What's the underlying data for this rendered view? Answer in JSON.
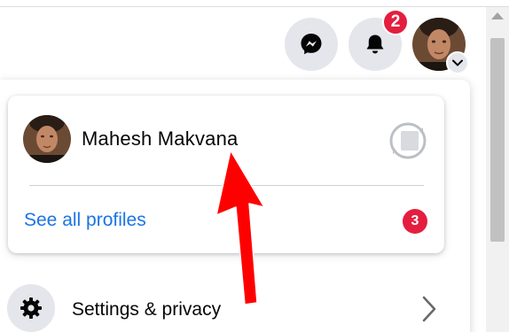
{
  "header": {
    "notifications_count": "2",
    "messenger_icon": "messenger-icon",
    "bell_icon": "bell-icon"
  },
  "profile_card": {
    "name": "Mahesh Makvana",
    "see_all_label": "See all profiles",
    "profiles_count": "3"
  },
  "menu": {
    "settings_label": "Settings & privacy"
  },
  "colors": {
    "accent_blue": "#1b74e4",
    "badge_red": "#e41e3f",
    "button_gray": "#e4e6eb",
    "annotation_red": "#ff0000"
  }
}
